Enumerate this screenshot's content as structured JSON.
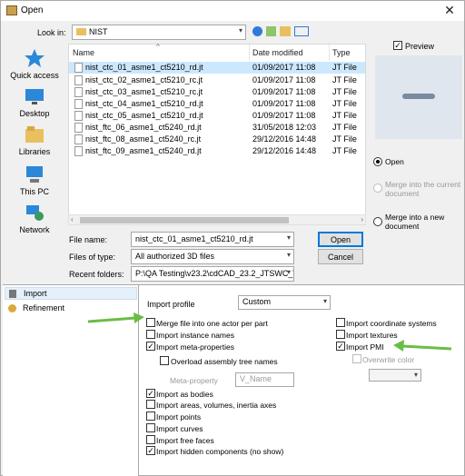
{
  "window": {
    "title": "Open"
  },
  "look_in": {
    "label": "Look in:",
    "value": "NIST"
  },
  "places": [
    {
      "label": "Quick access",
      "icon": "star-icon"
    },
    {
      "label": "Desktop",
      "icon": "desktop-icon"
    },
    {
      "label": "Libraries",
      "icon": "libraries-icon"
    },
    {
      "label": "This PC",
      "icon": "computer-icon"
    },
    {
      "label": "Network",
      "icon": "network-icon"
    }
  ],
  "columns": {
    "name": "Name",
    "date": "Date modified",
    "type": "Type"
  },
  "files": [
    {
      "name": "nist_ctc_01_asme1_ct5210_rd.jt",
      "date": "01/09/2017 11:08",
      "type": "JT File"
    },
    {
      "name": "nist_ctc_02_asme1_ct5210_rc.jt",
      "date": "01/09/2017 11:08",
      "type": "JT File"
    },
    {
      "name": "nist_ctc_03_asme1_ct5210_rc.jt",
      "date": "01/09/2017 11:08",
      "type": "JT File"
    },
    {
      "name": "nist_ctc_04_asme1_ct5210_rd.jt",
      "date": "01/09/2017 11:08",
      "type": "JT File"
    },
    {
      "name": "nist_ctc_05_asme1_ct5210_rd.jt",
      "date": "01/09/2017 11:08",
      "type": "JT File"
    },
    {
      "name": "nist_ftc_06_asme1_ct5240_rd.jt",
      "date": "31/05/2018 12:03",
      "type": "JT File"
    },
    {
      "name": "nist_ftc_08_asme1_ct5240_rc.jt",
      "date": "29/12/2016 14:48",
      "type": "JT File"
    },
    {
      "name": "nist_ftc_09_asme1_ct5240_rd.jt",
      "date": "29/12/2016 14:48",
      "type": "JT File"
    }
  ],
  "preview": {
    "label": "Preview",
    "checked": true
  },
  "radios": {
    "open": "Open",
    "merge_current": "Merge into the current document",
    "merge_new": "Merge into a new document"
  },
  "file_name": {
    "label": "File name:",
    "value": "nist_ctc_01_asme1_ct5210_rd.jt"
  },
  "files_of_type": {
    "label": "Files of type:",
    "value": "All authorized 3D files"
  },
  "recent_folders": {
    "label": "Recent folders:",
    "value": "P:\\QA Testing\\v23.2\\cdCAD_23.2_JTSWC_WI"
  },
  "buttons": {
    "open": "Open",
    "cancel": "Cancel"
  },
  "tree": {
    "import": "Import",
    "refinement": "Refinement"
  },
  "import_profile": {
    "label": "Import profile",
    "value": "Custom"
  },
  "options_left": {
    "merge_file": "Merge file into one actor per part",
    "instance_names": "Import instance names",
    "meta_properties": "Import meta-properties",
    "overload_tree": "Overload assembly tree names",
    "meta_property_label": "Meta-property",
    "meta_property_value": "V_Name",
    "as_bodies": "Import as bodies",
    "areas": "Import areas, volumes, inertia axes",
    "points": "Import points",
    "curves": "Import curves",
    "free_faces": "Import free faces",
    "hidden": "Import hidden components (no show)"
  },
  "options_right": {
    "coord_systems": "Import coordinate systems",
    "textures": "Import textures",
    "pmi": "Import PMI",
    "overwrite_color": "Overwrite color"
  },
  "colors": {
    "arrow": "#6abd45",
    "selection": "#cce8ff",
    "accent": "#0078d7"
  }
}
